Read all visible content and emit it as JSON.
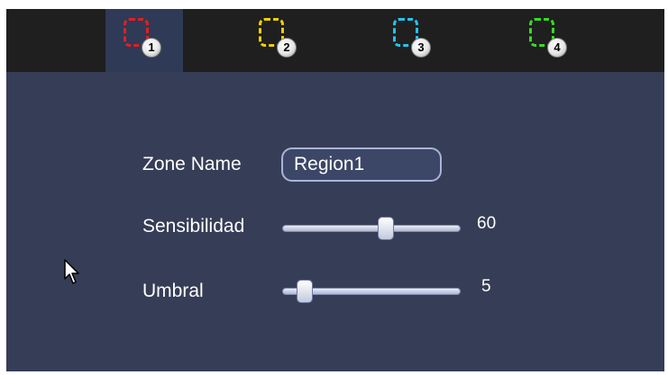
{
  "zone_tabs": [
    {
      "number": "1",
      "color": "#e02020",
      "active": true
    },
    {
      "number": "2",
      "color": "#f0d000",
      "active": false
    },
    {
      "number": "3",
      "color": "#22c4f0",
      "active": false
    },
    {
      "number": "4",
      "color": "#33dd22",
      "active": false
    }
  ],
  "form": {
    "zone_name_label": "Zone Name",
    "zone_name_value": "Region1",
    "sensitivity_label": "Sensibilidad",
    "sensitivity_value": "60",
    "sensitivity_fraction": 0.6,
    "threshold_label": "Umbral",
    "threshold_value": "5",
    "threshold_fraction": 0.05
  }
}
